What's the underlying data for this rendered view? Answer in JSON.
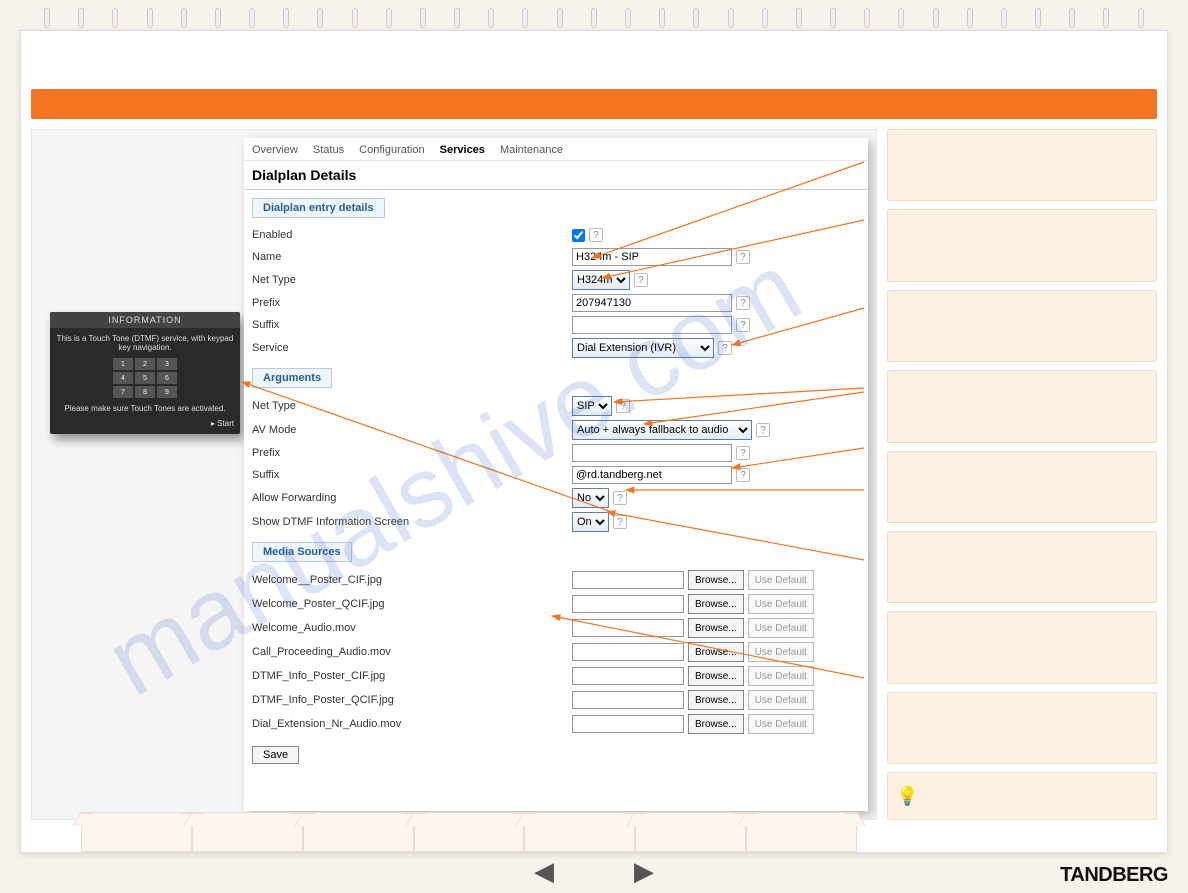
{
  "brand": "TANDBERG",
  "watermark": "manualshive.com",
  "orange_bar_title": "",
  "admin": {
    "tabs": {
      "overview": "Overview",
      "status": "Status",
      "configuration": "Configuration",
      "services": "Services",
      "maintenance": "Maintenance"
    },
    "page_title": "Dialplan Details",
    "section_entry": "Dialplan entry details",
    "section_arguments": "Arguments",
    "section_media": "Media Sources",
    "labels": {
      "enabled": "Enabled",
      "name": "Name",
      "net_type": "Net Type",
      "prefix": "Prefix",
      "suffix": "Suffix",
      "service": "Service",
      "arg_net_type": "Net Type",
      "av_mode": "AV Mode",
      "arg_prefix": "Prefix",
      "arg_suffix": "Suffix",
      "allow_forwarding": "Allow Forwarding",
      "show_dtmf": "Show DTMF Information Screen"
    },
    "values": {
      "name": "H324m - SIP",
      "net_type": "H324m",
      "prefix": "207947130",
      "suffix": "",
      "service": "Dial Extension (IVR)",
      "arg_net_type": "SIP",
      "av_mode": "Auto + always fallback to audio",
      "arg_prefix": "",
      "arg_suffix": "@rd.tandberg.net",
      "allow_forwarding": "No",
      "show_dtmf": "On"
    },
    "media": [
      "Welcome__Poster_CIF.jpg",
      "Welcome_Poster_QCIF.jpg",
      "Welcome_Audio.mov",
      "Call_Proceeding_Audio.mov",
      "DTMF_Info_Poster_CIF.jpg",
      "DTMF_Info_Poster_QCIF.jpg",
      "Dial_Extension_Nr_Audio.mov"
    ],
    "buttons": {
      "browse": "Browse...",
      "use_default": "Use Default",
      "save": "Save"
    }
  },
  "info_box": {
    "title": "INFORMATION",
    "line1": "This is a Touch Tone (DTMF) service, with keypad key navigation.",
    "line2": "Please make sure Touch Tones are activated.",
    "start": "Start"
  },
  "help_char": "?",
  "pager": {
    "prev": "◀",
    "next": "▶"
  }
}
